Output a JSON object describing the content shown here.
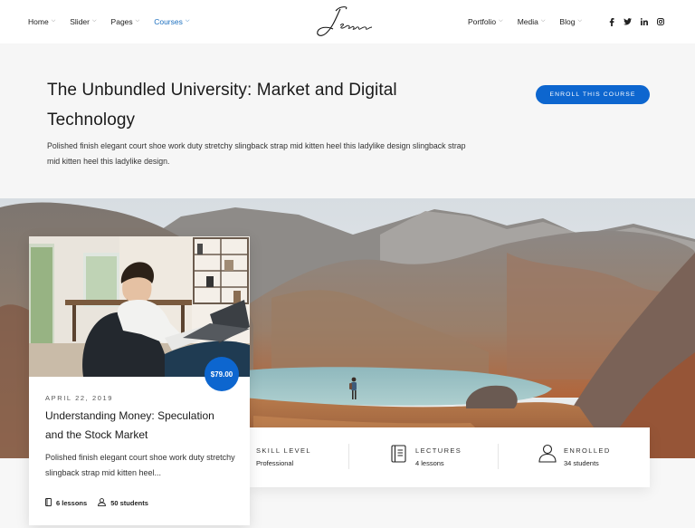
{
  "nav": {
    "left": [
      {
        "label": "Home",
        "active": false
      },
      {
        "label": "Slider",
        "active": false
      },
      {
        "label": "Pages",
        "active": false
      },
      {
        "label": "Courses",
        "active": true
      }
    ],
    "logo_text": "Jessica",
    "right": [
      {
        "label": "Portfolio"
      },
      {
        "label": "Media"
      },
      {
        "label": "Blog"
      }
    ],
    "socials": [
      "facebook-icon",
      "twitter-icon",
      "linkedin-icon",
      "instagram-icon"
    ]
  },
  "header": {
    "title": "The Unbundled University: Market and Digital Technology",
    "description": "Polished finish elegant court shoe work duty stretchy slingback strap mid kitten heel this ladylike design slingback strap mid kitten heel this ladylike design.",
    "enroll_label": "Enroll this course",
    "accent_color": "#0d66cf"
  },
  "card": {
    "price": "$79.00",
    "date": "April 22, 2019",
    "title": "Understanding Money: Speculation and the Stock Market",
    "description": "Polished finish elegant court shoe work duty stretchy slingback strap mid kitten heel...",
    "lessons": "6 lessons",
    "students": "50 students"
  },
  "stats": {
    "skill_label": "Skill Level",
    "skill_value": "Professional",
    "lectures_label": "Lectures",
    "lectures_value": "4 lessons",
    "enrolled_label": "Enrolled",
    "enrolled_value": "34 students"
  }
}
